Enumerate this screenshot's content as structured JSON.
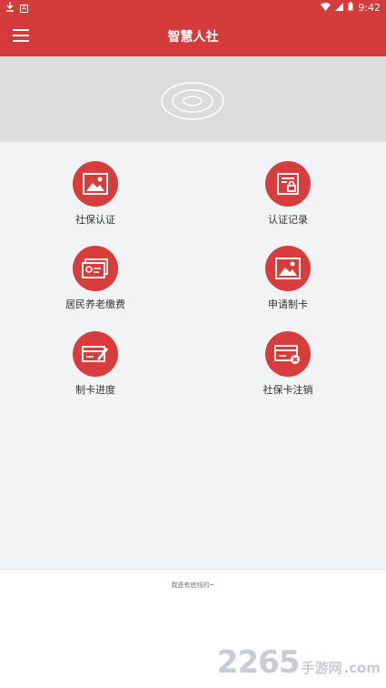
{
  "status_bar": {
    "left_icons": [
      "download-icon",
      "a-box-icon"
    ],
    "time": "9:42",
    "right_icons": [
      "wifi-icon",
      "signal-icon",
      "battery-icon"
    ]
  },
  "app_bar": {
    "title": "智慧人社",
    "menu_icon": "hamburger-menu-icon"
  },
  "banner": {
    "logo_icon": "ripple-logo-icon"
  },
  "grid": [
    {
      "label": "社保认证",
      "icon": "image-icon"
    },
    {
      "label": "认证记录",
      "icon": "record-lock-icon"
    },
    {
      "label": "居民养老缴费",
      "icon": "card-payment-icon"
    },
    {
      "label": "申请制卡",
      "icon": "image-icon"
    },
    {
      "label": "制卡进度",
      "icon": "card-pen-icon"
    },
    {
      "label": "社保卡注销",
      "icon": "card-cancel-icon"
    }
  ],
  "footer": {
    "text": "我是有底线的~"
  },
  "watermark": {
    "number": "2265",
    "text": "手游网",
    "suffix": ".com"
  },
  "colors": {
    "primary": "#d63b3b",
    "background": "#f2f3f5",
    "banner": "#dcdcdc"
  }
}
